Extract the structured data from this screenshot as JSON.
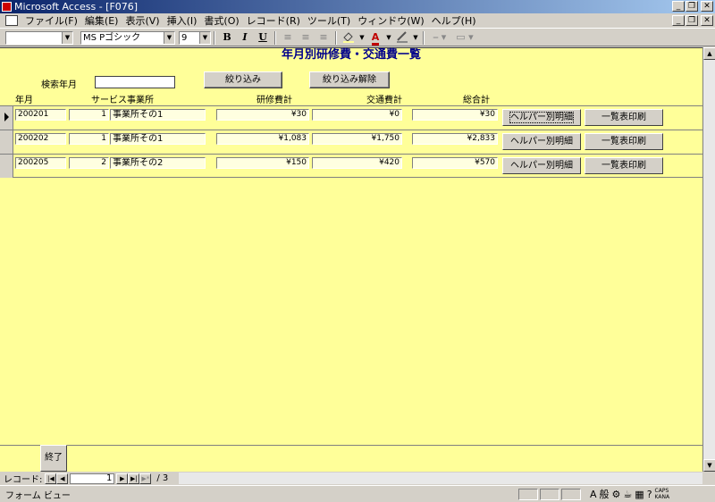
{
  "window": {
    "title": "Microsoft Access - [F076]",
    "btn_min": "_",
    "btn_restore": "❐",
    "btn_close": "✕"
  },
  "menu": {
    "items": [
      "ファイル(F)",
      "編集(E)",
      "表示(V)",
      "挿入(I)",
      "書式(O)",
      "レコード(R)",
      "ツール(T)",
      "ウィンドウ(W)",
      "ヘルプ(H)"
    ]
  },
  "toolbar": {
    "object_combo": "",
    "font_name": "MS Pゴシック",
    "font_size": "9",
    "bold": "B",
    "italic": "I",
    "underline": "U",
    "font_color": "A",
    "font_color_hex": "#c00000"
  },
  "form": {
    "title": "年月別研修費・交通費一覧",
    "search_label": "検索年月",
    "search_value": "",
    "filter_button": "絞り込み",
    "clear_filter_button": "絞り込み解除",
    "headers": {
      "yearmonth": "年月",
      "office": "サービス事業所",
      "training": "研修費計",
      "transport": "交通費計",
      "total": "総合計"
    },
    "rows": [
      {
        "yearmonth": "200201",
        "office_no": "1",
        "office_name": "事業所その1",
        "training": "¥30",
        "transport": "¥0",
        "total": "¥30",
        "detail_button": "ヘルパー別明細",
        "print_button": "一覧表印刷"
      },
      {
        "yearmonth": "200202",
        "office_no": "1",
        "office_name": "事業所その1",
        "training": "¥1,083",
        "transport": "¥1,750",
        "total": "¥2,833",
        "detail_button": "ヘルパー別明細",
        "print_button": "一覧表印刷"
      },
      {
        "yearmonth": "200205",
        "office_no": "2",
        "office_name": "事業所その2",
        "training": "¥150",
        "transport": "¥420",
        "total": "¥570",
        "detail_button": "ヘルパー別明細",
        "print_button": "一覧表印刷"
      }
    ],
    "end_button": "終了"
  },
  "nav": {
    "label": "レコード:",
    "current": "1",
    "of_text": "/ 3",
    "first": "|◀",
    "prev": "◀",
    "next": "▶",
    "last": "▶|",
    "new": "▶*"
  },
  "status": {
    "text": "フォーム ビュー",
    "ime_mode": "般",
    "caps": "CAPS",
    "kana": "KANA"
  }
}
